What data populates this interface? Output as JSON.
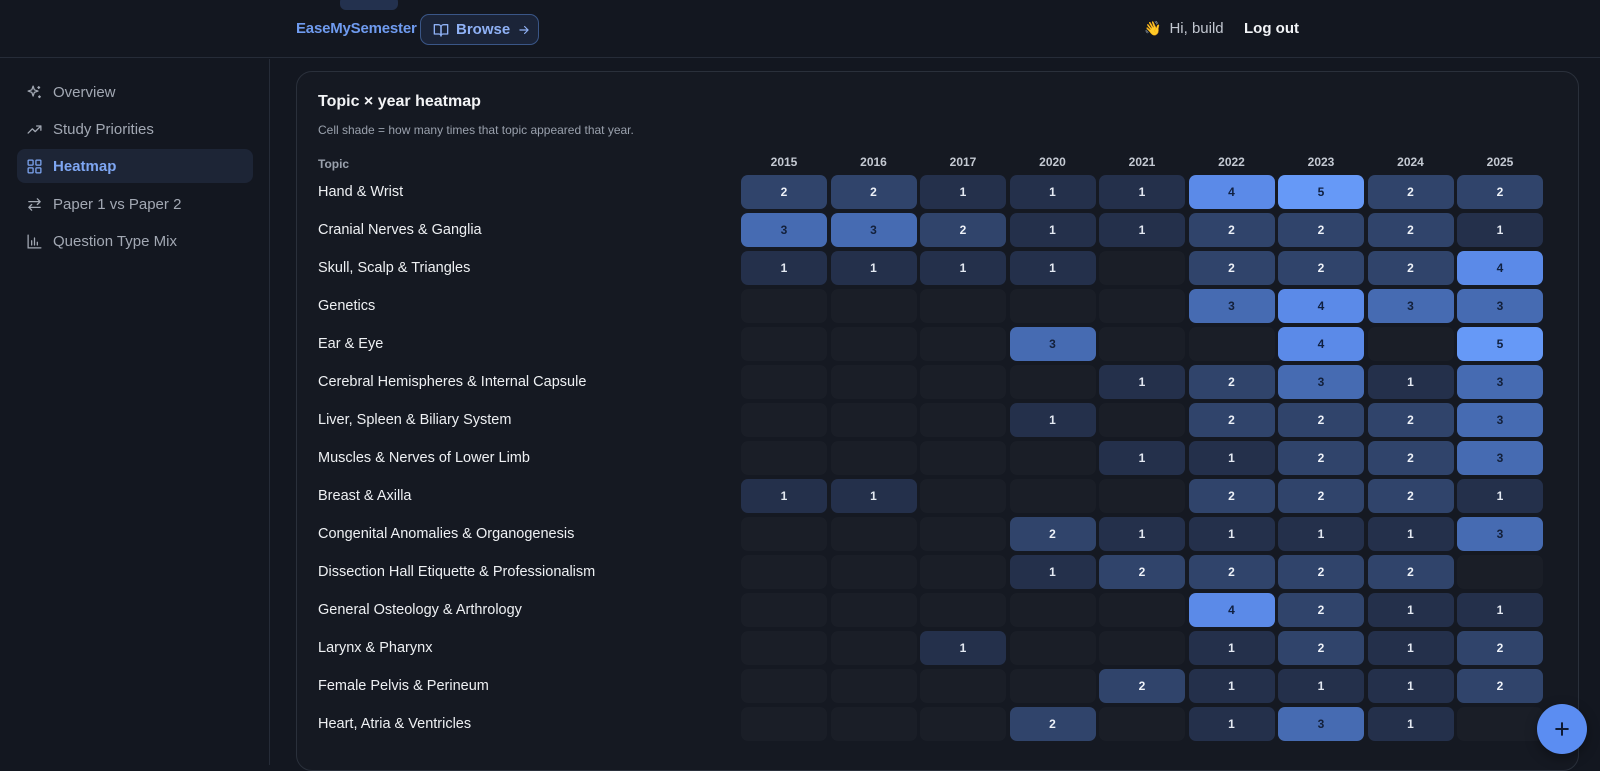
{
  "header": {
    "brand": "EaseMySemester",
    "browse_label": "Browse",
    "greeting_emoji": "👋",
    "greeting": "Hi, build",
    "logout_label": "Log out"
  },
  "sidebar": {
    "items": [
      {
        "label": "Overview",
        "icon": "sparkles-icon",
        "active": false
      },
      {
        "label": "Study Priorities",
        "icon": "trending-up-icon",
        "active": false
      },
      {
        "label": "Heatmap",
        "icon": "grid-icon",
        "active": true
      },
      {
        "label": "Paper 1 vs Paper 2",
        "icon": "swap-arrows-icon",
        "active": false
      },
      {
        "label": "Question Type Mix",
        "icon": "bar-chart-icon",
        "active": false
      }
    ]
  },
  "heatmap": {
    "title": "Topic × year heatmap",
    "subtitle": "Cell shade = how many times that topic appeared that year.",
    "topic_header": "Topic",
    "years": [
      "2015",
      "2016",
      "2017",
      "2020",
      "2021",
      "2022",
      "2023",
      "2024",
      "2025"
    ],
    "rows": [
      {
        "topic": "Hand & Wrist",
        "values": [
          2,
          2,
          1,
          1,
          1,
          4,
          5,
          2,
          2
        ]
      },
      {
        "topic": "Cranial Nerves & Ganglia",
        "values": [
          3,
          3,
          2,
          1,
          1,
          2,
          2,
          2,
          1
        ]
      },
      {
        "topic": "Skull, Scalp & Triangles",
        "values": [
          1,
          1,
          1,
          1,
          0,
          2,
          2,
          2,
          4
        ]
      },
      {
        "topic": "Genetics",
        "values": [
          0,
          0,
          0,
          0,
          0,
          3,
          4,
          3,
          3
        ]
      },
      {
        "topic": "Ear & Eye",
        "values": [
          0,
          0,
          0,
          3,
          0,
          0,
          4,
          0,
          5
        ]
      },
      {
        "topic": "Cerebral Hemispheres & Internal Capsule",
        "values": [
          0,
          0,
          0,
          0,
          1,
          2,
          3,
          1,
          3
        ]
      },
      {
        "topic": "Liver, Spleen & Biliary System",
        "values": [
          0,
          0,
          0,
          1,
          0,
          2,
          2,
          2,
          3
        ]
      },
      {
        "topic": "Muscles & Nerves of Lower Limb",
        "values": [
          0,
          0,
          0,
          0,
          1,
          1,
          2,
          2,
          3
        ]
      },
      {
        "topic": "Breast & Axilla",
        "values": [
          1,
          1,
          0,
          0,
          0,
          2,
          2,
          2,
          1
        ]
      },
      {
        "topic": "Congenital Anomalies & Organogenesis",
        "values": [
          0,
          0,
          0,
          2,
          1,
          1,
          1,
          1,
          3
        ]
      },
      {
        "topic": "Dissection Hall Etiquette & Professionalism",
        "values": [
          0,
          0,
          0,
          1,
          2,
          2,
          2,
          2,
          0
        ]
      },
      {
        "topic": "General Osteology & Arthrology",
        "values": [
          0,
          0,
          0,
          0,
          0,
          4,
          2,
          1,
          1
        ]
      },
      {
        "topic": "Larynx & Pharynx",
        "values": [
          0,
          0,
          1,
          0,
          0,
          1,
          2,
          1,
          2
        ]
      },
      {
        "topic": "Female Pelvis & Perineum",
        "values": [
          0,
          0,
          0,
          0,
          2,
          1,
          1,
          1,
          2
        ]
      },
      {
        "topic": "Heart, Atria & Ventricles",
        "values": [
          0,
          0,
          0,
          2,
          0,
          1,
          3,
          1,
          0
        ]
      }
    ]
  },
  "fab": {
    "icon": "plus-icon"
  }
}
